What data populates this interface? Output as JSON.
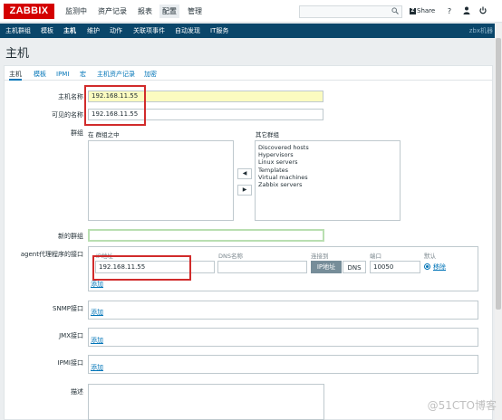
{
  "header": {
    "logo": "ZABBIX",
    "menu": [
      "监测中",
      "资产记录",
      "报表",
      "配置",
      "管理"
    ],
    "share_label": "Share",
    "icons": [
      "search-icon",
      "help-icon",
      "user-icon",
      "power-icon"
    ]
  },
  "submenu": {
    "items": [
      "主机群组",
      "模板",
      "主机",
      "维护",
      "动作",
      "关联项事件",
      "自动发现",
      "IT服务"
    ],
    "right_text": "zbx机器"
  },
  "page": {
    "title": "主机"
  },
  "tabs": [
    "主机",
    "模板",
    "IPMI",
    "宏",
    "主机资产记录",
    "加密"
  ],
  "form": {
    "host_name_label": "主机名称",
    "host_name_value": "192.168.11.55",
    "visible_name_label": "可见的名称",
    "visible_name_value": "192.168.11.55",
    "groups_label": "群组",
    "in_groups_label": "在 群组之中",
    "other_groups_label": "其它群组",
    "other_groups": [
      "Discovered hosts",
      "Hypervisors",
      "Linux servers",
      "Templates",
      "Virtual machines",
      "Zabbix servers"
    ],
    "move_left": "◀",
    "move_right": "▶",
    "new_group_label": "新的群组",
    "agent_label": "agent代理程序的接口",
    "agent_headers": {
      "ip": "IP地址",
      "dns": "DNS名称",
      "connect": "连接到",
      "port": "端口",
      "default": "默认"
    },
    "agent_ip_value": "192.168.11.55",
    "connect_ip": "IP地址",
    "connect_dns": "DNS",
    "port_value": "10050",
    "remove_label": "移除",
    "add_label": "添加",
    "snmp_label": "SNMP接口",
    "jmx_label": "JMX接口",
    "ipmi_label": "IPMI接口",
    "description_label": "描述"
  },
  "watermark": "@51CTO博客"
}
